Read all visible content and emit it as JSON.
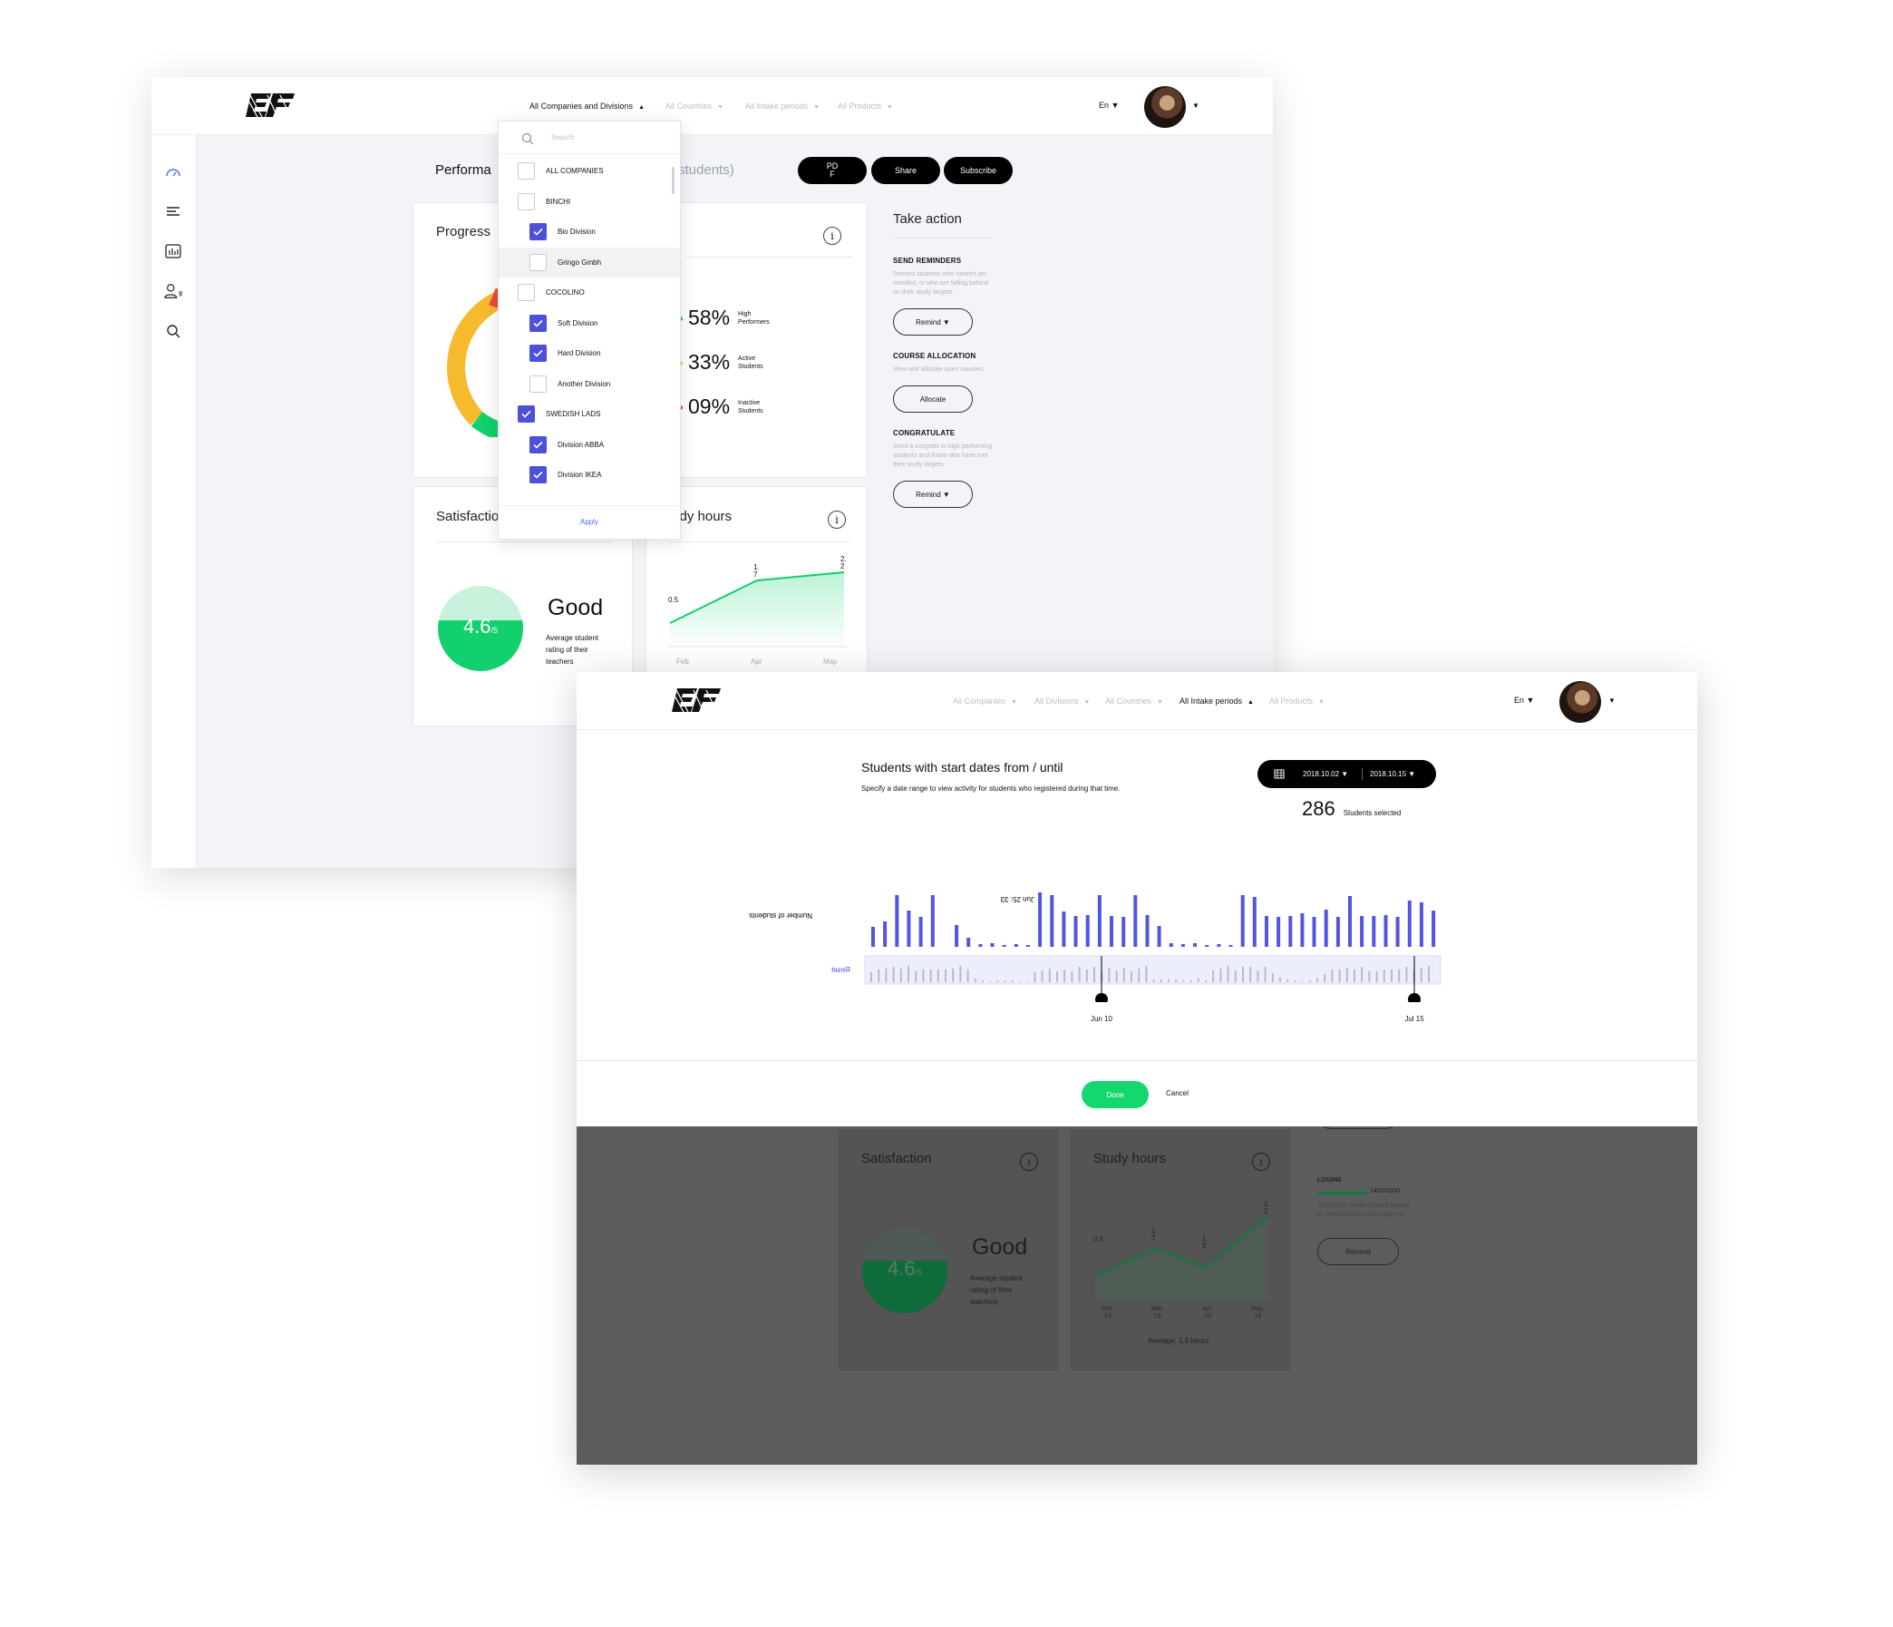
{
  "back": {
    "logo_text": "EF",
    "filters": [
      {
        "label": "All Companies and Divisions",
        "caret": "▲",
        "active": true
      },
      {
        "label": "All Countries",
        "caret": "▼",
        "active": false
      },
      {
        "label": "All Intake periods",
        "caret": "▼",
        "active": false
      },
      {
        "label": "All Products",
        "caret": "▼",
        "active": false
      }
    ],
    "lang": "En ▼",
    "avatar_caret": "▼",
    "page_title": "Performa",
    "page_title_hidden": "students)",
    "buttons": {
      "pdf": "PD\nF",
      "share": "Share",
      "subscribe": "Subscribe"
    },
    "progress_title": "Progress",
    "progress_stats": [
      {
        "pct": "58%",
        "label": "High\nPerformers",
        "color": "#12c38a"
      },
      {
        "pct": "33%",
        "label": "Active\nStudents",
        "color": "#f6b93b"
      },
      {
        "pct": "09%",
        "label": "Inactive\nStudents",
        "color": "#ef4a3a"
      }
    ],
    "donut": [
      {
        "value": 58,
        "color": "#f7ba2e"
      },
      {
        "value": 33,
        "color": "#12d06d"
      },
      {
        "value": 9,
        "color": "#ef4a3a"
      }
    ],
    "satisfaction_title": "Satisfactio",
    "study_hours_title": "tudy hours",
    "rating": {
      "value": "4.6",
      "suffix": "/5",
      "word": "Good",
      "desc": "Average student\nrating of their\nteachers"
    },
    "study_chart": {
      "y_label": "0.5",
      "x_labels": [
        "Feb",
        "Apr",
        "May"
      ],
      "point_labels": [
        "1.\n7",
        "2.\n2"
      ],
      "values": [
        0.5,
        1.7,
        2.2
      ]
    },
    "take_action": {
      "title": "Take action",
      "sections": [
        {
          "head": "SEND REMINDERS",
          "desc": "Remind students who haven't yet enrolled, or who are falling behind on their study targets.",
          "button": "Remind ▼"
        },
        {
          "head": "COURSE ALLOCATION",
          "desc": "View and allocate open courses.",
          "button": "Allocate"
        },
        {
          "head": "CONGRATULATE",
          "desc": "Send a congrats to high performing students and those who have met their study targets.",
          "button": "Remind ▼"
        }
      ]
    },
    "dropdown": {
      "search_placeholder": "Search",
      "items": [
        {
          "label": "ALL COMPANIES",
          "level": 0,
          "checked": false
        },
        {
          "label": "BINCHI",
          "level": 0,
          "checked": false
        },
        {
          "label": "Bio Division",
          "level": 1,
          "checked": true
        },
        {
          "label": "Gringo Gmbh",
          "level": 1,
          "checked": false,
          "highlight": true
        },
        {
          "label": "COCOLINO",
          "level": 0,
          "checked": false
        },
        {
          "label": "Soft Division",
          "level": 1,
          "checked": true
        },
        {
          "label": "Hard Division",
          "level": 1,
          "checked": true
        },
        {
          "label": "Another Division",
          "level": 1,
          "checked": false
        },
        {
          "label": "SWEDISH LADS",
          "level": 0,
          "checked": true
        },
        {
          "label": "Division ABBA",
          "level": 1,
          "checked": true
        },
        {
          "label": "Division IKEA",
          "level": 1,
          "checked": true
        }
      ],
      "apply": "Apply"
    }
  },
  "front": {
    "logo_text": "EF",
    "filters": [
      {
        "label": "All Companies",
        "caret": "▼",
        "active": false
      },
      {
        "label": "All Divisions",
        "caret": "▼",
        "active": false
      },
      {
        "label": "All Countries",
        "caret": "▼",
        "active": false
      },
      {
        "label": "All Intake periods",
        "caret": "▲",
        "active": true
      },
      {
        "label": "All Products",
        "caret": "▼",
        "active": false
      }
    ],
    "lang": "En ▼",
    "avatar_caret": "▼",
    "modal": {
      "title": "Students with start dates from / until",
      "subtitle": "Specify a date range to view activity for students who registered during that time.",
      "date_from": "2018.10.02 ▼",
      "date_to": "2018.10.15 ▼",
      "selected_count": "286",
      "selected_label": "Students selected",
      "range_start": "Jun 10",
      "range_end": "Jul 15",
      "done": "Done",
      "cancel": "Cancel",
      "reset": "Reset",
      "y_axis_label": "Number of students",
      "tooltip": "Jun 25: 33"
    },
    "dim": {
      "satisfaction_title": "Satisfaction",
      "study_hours_title": "Study hours",
      "rating_value": "4.6",
      "rating_suffix": "/5",
      "rating_word": "Good",
      "rating_desc": "Average student\nrating of their\nteachers",
      "study_y": "0.5",
      "study_points": [
        "1.\n7",
        "1.\n2",
        "2.\n2"
      ],
      "study_x": [
        "Feb\n'19",
        "Mar\n'19",
        "Apr\n'19",
        "May\n'19"
      ],
      "study_avg": "Average: 1.9 hours",
      "logins_head": "LOGINS",
      "logins_value": "1420/1500",
      "logins_desc": "1420/1500 students have logged in. Remind those who have not",
      "remind": "Remind"
    }
  },
  "chart_data": {
    "type": "bar",
    "title": "",
    "ylabel": "Number of students",
    "xlabel": "",
    "values": [
      22,
      28,
      57,
      40,
      33,
      57,
      0,
      24,
      10,
      3,
      4,
      2,
      3,
      2,
      60,
      57,
      39,
      34,
      35,
      57,
      34,
      33,
      57,
      35,
      23,
      4,
      3,
      4,
      2,
      3,
      2,
      57,
      55,
      34,
      33,
      34,
      37,
      33,
      41,
      33,
      56,
      34,
      34,
      35,
      33,
      51,
      49,
      40
    ],
    "brush_values": [
      11,
      14,
      15,
      17,
      15,
      18,
      12,
      14,
      14,
      14,
      14,
      15,
      18,
      14,
      4,
      2,
      1,
      2,
      2,
      2,
      1,
      1,
      11,
      13,
      15,
      12,
      14,
      12,
      17,
      14,
      17,
      12,
      16,
      13,
      16,
      12,
      15,
      18,
      3,
      3,
      3,
      3,
      2,
      2,
      4,
      2,
      13,
      15,
      18,
      13,
      17,
      17,
      13,
      17,
      10,
      5,
      3,
      2,
      1,
      2,
      4,
      9,
      14,
      14,
      16,
      14,
      17,
      12,
      12,
      14,
      14,
      14,
      17,
      13,
      16,
      18
    ],
    "range": [
      "Jun 10",
      "Jul 15"
    ],
    "annotations": [
      "Jun 25: 33"
    ],
    "ylim": [
      0,
      60
    ]
  }
}
